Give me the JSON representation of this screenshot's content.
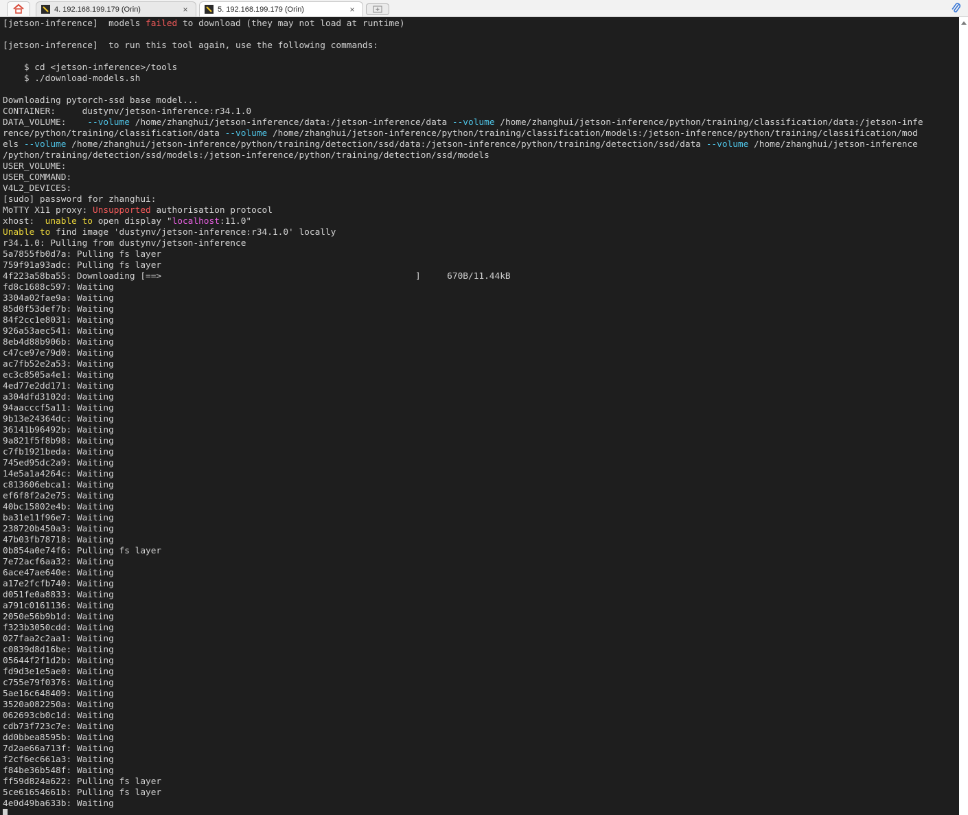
{
  "tabs": [
    {
      "label": "4. 192.168.199.179 (Orin)",
      "active": false,
      "icon": "wrench-icon"
    },
    {
      "label": "5. 192.168.199.179 (Orin)",
      "active": true,
      "icon": "wrench-icon"
    }
  ],
  "tab_close_glyph": "×",
  "colors": {
    "home_icon": "#d94d3c",
    "tab_icon_bg": "#2b2b2b",
    "tab_icon_fg": "#f2c624",
    "attach_icon": "#3a78d6"
  },
  "terminal": {
    "lines": [
      [
        {
          "t": "[jetson-inference]  models "
        },
        {
          "t": "failed",
          "c": "red"
        },
        {
          "t": " to download (they may not load at runtime)"
        }
      ],
      [],
      [
        {
          "t": "[jetson-inference]  to run this tool again, use the following commands:"
        }
      ],
      [],
      [
        {
          "t": "    $ cd <jetson-inference>/tools"
        }
      ],
      [
        {
          "t": "    $ ./download-models.sh"
        }
      ],
      [],
      [
        {
          "t": "Downloading pytorch-ssd base model..."
        }
      ],
      [
        {
          "t": "CONTAINER:     dustynv/jetson-inference:r34.1.0"
        }
      ],
      [
        {
          "t": "DATA_VOLUME:    "
        },
        {
          "t": "--volume",
          "c": "cyan"
        },
        {
          "t": " /home/zhanghui/jetson-inference/data:/jetson-inference/data "
        },
        {
          "t": "--volume",
          "c": "cyan"
        },
        {
          "t": " /home/zhanghui/jetson-inference/python/training/classification/data:/jetson-infe"
        }
      ],
      [
        {
          "t": "rence/python/training/classification/data "
        },
        {
          "t": "--volume",
          "c": "cyan"
        },
        {
          "t": " /home/zhanghui/jetson-inference/python/training/classification/models:/jetson-inference/python/training/classification/mod"
        }
      ],
      [
        {
          "t": "els "
        },
        {
          "t": "--volume",
          "c": "cyan"
        },
        {
          "t": " /home/zhanghui/jetson-inference/python/training/detection/ssd/data:/jetson-inference/python/training/detection/ssd/data "
        },
        {
          "t": "--volume",
          "c": "cyan"
        },
        {
          "t": " /home/zhanghui/jetson-inference"
        }
      ],
      [
        {
          "t": "/python/training/detection/ssd/models:/jetson-inference/python/training/detection/ssd/models"
        }
      ],
      [
        {
          "t": "USER_VOLUME:"
        }
      ],
      [
        {
          "t": "USER_COMMAND:"
        }
      ],
      [
        {
          "t": "V4L2_DEVICES:"
        }
      ],
      [
        {
          "t": "[sudo] password for zhanghui:"
        }
      ],
      [
        {
          "t": "MoTTY X11 proxy: "
        },
        {
          "t": "Unsupported",
          "c": "red"
        },
        {
          "t": " authorisation protocol"
        }
      ],
      [
        {
          "t": "xhost:  "
        },
        {
          "t": "unable to",
          "c": "yellow"
        },
        {
          "t": " open display \""
        },
        {
          "t": "localhost",
          "c": "magenta"
        },
        {
          "t": ":11.0\""
        }
      ],
      [
        {
          "t": "Unable to",
          "c": "yellow"
        },
        {
          "t": " find image 'dustynv/jetson-inference:r34.1.0' locally"
        }
      ],
      [
        {
          "t": "r34.1.0: Pulling from dustynv/jetson-inference"
        }
      ],
      [
        {
          "t": "5a7855fb0d7a: Pulling fs layer"
        }
      ],
      [
        {
          "t": "759f91a93adc: Pulling fs layer"
        }
      ],
      [
        {
          "t": "4f223a58ba55: Downloading [==>                                                ]     670B/11.44kB"
        }
      ],
      [
        {
          "t": "fd8c1688c597: Waiting"
        }
      ],
      [
        {
          "t": "3304a02fae9a: Waiting"
        }
      ],
      [
        {
          "t": "85d0f53def7b: Waiting"
        }
      ],
      [
        {
          "t": "84f2cc1e8031: Waiting"
        }
      ],
      [
        {
          "t": "926a53aec541: Waiting"
        }
      ],
      [
        {
          "t": "8eb4d88b906b: Waiting"
        }
      ],
      [
        {
          "t": "c47ce97e79d0: Waiting"
        }
      ],
      [
        {
          "t": "ac7fb52e2a53: Waiting"
        }
      ],
      [
        {
          "t": "ec3c8505a4e1: Waiting"
        }
      ],
      [
        {
          "t": "4ed77e2dd171: Waiting"
        }
      ],
      [
        {
          "t": "a304dfd3102d: Waiting"
        }
      ],
      [
        {
          "t": "94aacccf5a11: Waiting"
        }
      ],
      [
        {
          "t": "9b13e24364dc: Waiting"
        }
      ],
      [
        {
          "t": "36141b96492b: Waiting"
        }
      ],
      [
        {
          "t": "9a821f5f8b98: Waiting"
        }
      ],
      [
        {
          "t": "c7fb1921beda: Waiting"
        }
      ],
      [
        {
          "t": "745ed95dc2a9: Waiting"
        }
      ],
      [
        {
          "t": "14e5a1a4264c: Waiting"
        }
      ],
      [
        {
          "t": "c813606ebca1: Waiting"
        }
      ],
      [
        {
          "t": "ef6f8f2a2e75: Waiting"
        }
      ],
      [
        {
          "t": "40bc15802e4b: Waiting"
        }
      ],
      [
        {
          "t": "ba31e11f96e7: Waiting"
        }
      ],
      [
        {
          "t": "238720b450a3: Waiting"
        }
      ],
      [
        {
          "t": "47b03fb78718: Waiting"
        }
      ],
      [
        {
          "t": "0b854a0e74f6: Pulling fs layer"
        }
      ],
      [
        {
          "t": "7e72acf6aa32: Waiting"
        }
      ],
      [
        {
          "t": "6ace47ae640e: Waiting"
        }
      ],
      [
        {
          "t": "a17e2fcfb740: Waiting"
        }
      ],
      [
        {
          "t": "d051fe0a8833: Waiting"
        }
      ],
      [
        {
          "t": "a791c0161136: Waiting"
        }
      ],
      [
        {
          "t": "2050e56b9b1d: Waiting"
        }
      ],
      [
        {
          "t": "f323b3050cdd: Waiting"
        }
      ],
      [
        {
          "t": "027faa2c2aa1: Waiting"
        }
      ],
      [
        {
          "t": "c0839d8d16be: Waiting"
        }
      ],
      [
        {
          "t": "05644f2f1d2b: Waiting"
        }
      ],
      [
        {
          "t": "fd9d3e1e5ae0: Waiting"
        }
      ],
      [
        {
          "t": "c755e79f0376: Waiting"
        }
      ],
      [
        {
          "t": "5ae16c648409: Waiting"
        }
      ],
      [
        {
          "t": "3520a082250a: Waiting"
        }
      ],
      [
        {
          "t": "062693cb0c1d: Waiting"
        }
      ],
      [
        {
          "t": "cdb73f723c7e: Waiting"
        }
      ],
      [
        {
          "t": "dd0bbea8595b: Waiting"
        }
      ],
      [
        {
          "t": "7d2ae66a713f: Waiting"
        }
      ],
      [
        {
          "t": "f2cf6ec661a3: Waiting"
        }
      ],
      [
        {
          "t": "f84be36b548f: Waiting"
        }
      ],
      [
        {
          "t": "ff59d824a622: Pulling fs layer"
        }
      ],
      [
        {
          "t": "5ce61654661b: Pulling fs layer"
        }
      ],
      [
        {
          "t": "4e0d49ba633b: Waiting"
        }
      ]
    ]
  }
}
